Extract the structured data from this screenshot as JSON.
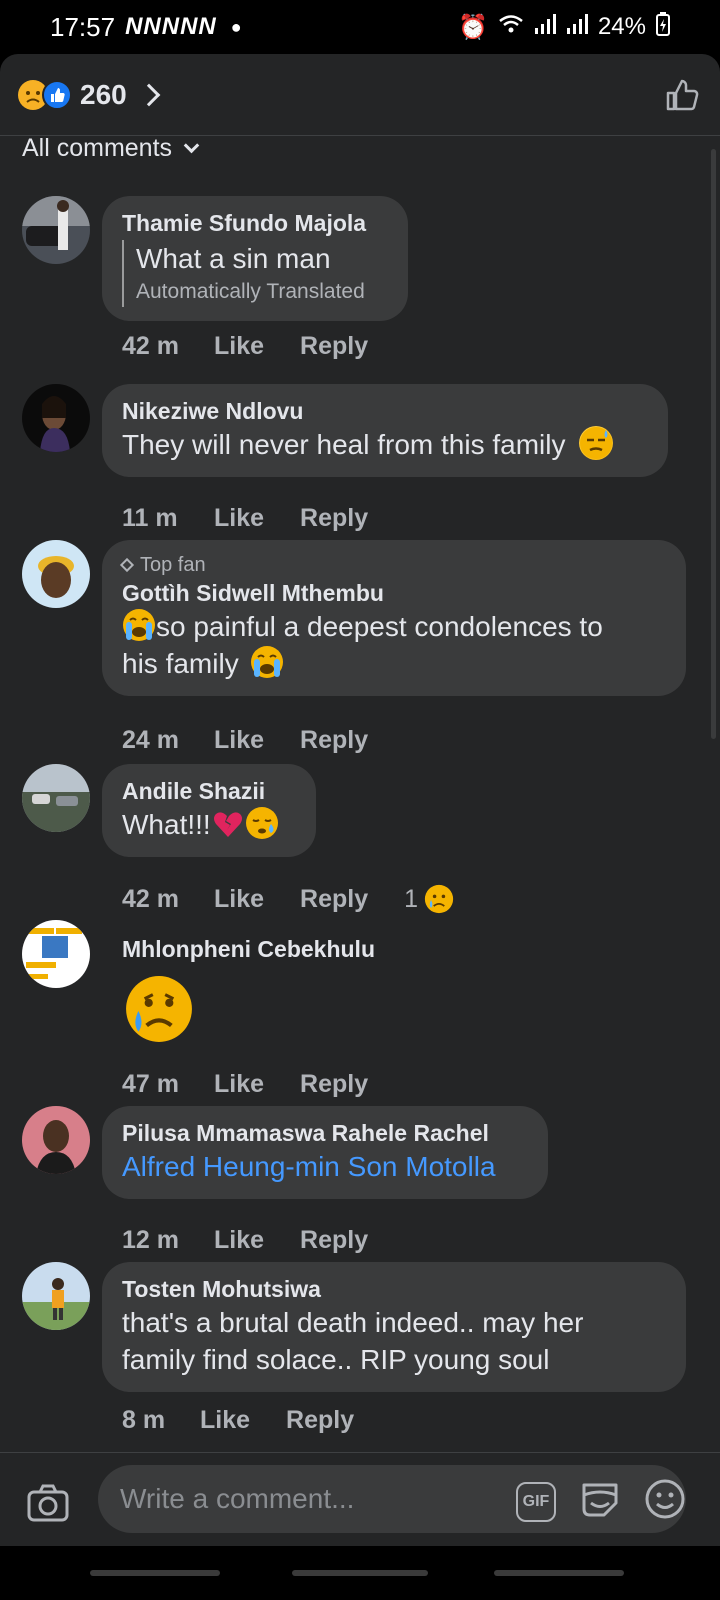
{
  "status_bar": {
    "time": "17:57",
    "notification_icons": "NNNNN",
    "battery": "24%"
  },
  "header": {
    "reaction_count": "260",
    "reactions": [
      "sad-reaction-icon",
      "like-reaction-icon"
    ]
  },
  "filter": {
    "label": "All comments"
  },
  "comments": [
    {
      "author": "Thamie Sfundo Majola",
      "text": "What a sin man",
      "translated_note": "Automatically Translated",
      "time": "42 m",
      "like": "Like",
      "reply": "Reply"
    },
    {
      "author": "Nikeziwe Ndlovu",
      "text": "They will never heal from this family",
      "time": "11 m",
      "like": "Like",
      "reply": "Reply"
    },
    {
      "badge": "Top fan",
      "author": "Gottìh Sidwell Mthembu",
      "text_line1": "so painful a deepest condolences to",
      "text_line2": "his family",
      "time": "24 m",
      "like": "Like",
      "reply": "Reply"
    },
    {
      "author": "Andile Shazii",
      "text": "What!!!",
      "time": "42 m",
      "like": "Like",
      "reply": "Reply",
      "reaction_count": "1"
    },
    {
      "author": "Mhlonpheni Cebekhulu",
      "time": "47 m",
      "like": "Like",
      "reply": "Reply"
    },
    {
      "author": "Pilusa Mmamaswa Rahele Rachel",
      "text": "Alfred Heung-min Son Motolla",
      "time": "12 m",
      "like": "Like",
      "reply": "Reply"
    },
    {
      "author": "Tosten Mohutsiwa",
      "text_line1": "that's a brutal death indeed.. may her",
      "text_line2": "family find solace.. RIP young soul",
      "time": "8 m",
      "like": "Like",
      "reply": "Reply"
    }
  ],
  "composer": {
    "placeholder": "Write a comment...",
    "gif_label": "GIF"
  },
  "colors": {
    "background": "#242526",
    "bubble": "#3a3b3c",
    "link": "#4599ff",
    "secondary_text": "#b0b3b8"
  }
}
